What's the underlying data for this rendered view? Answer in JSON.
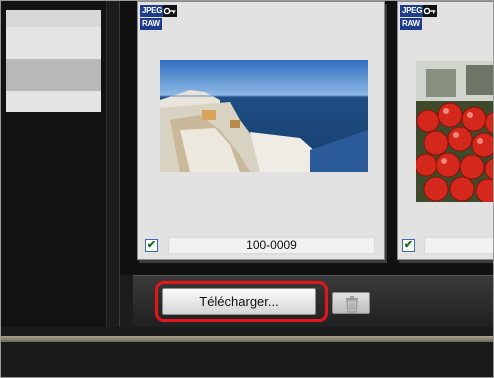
{
  "thumbnails": [
    {
      "badge_top": "JPEG",
      "badge_bottom": "RAW",
      "file_name": "100-0009",
      "checked": "✔"
    },
    {
      "badge_top": "JPEG",
      "badge_bottom": "RAW",
      "file_name": "",
      "checked": "✔"
    }
  ],
  "toolbar": {
    "download_label": "Télécharger...",
    "trash_icon": "trash-icon"
  },
  "colors": {
    "highlight": "#e3161b",
    "badge": "#1e3c8c",
    "check": "#1a6e1a"
  }
}
